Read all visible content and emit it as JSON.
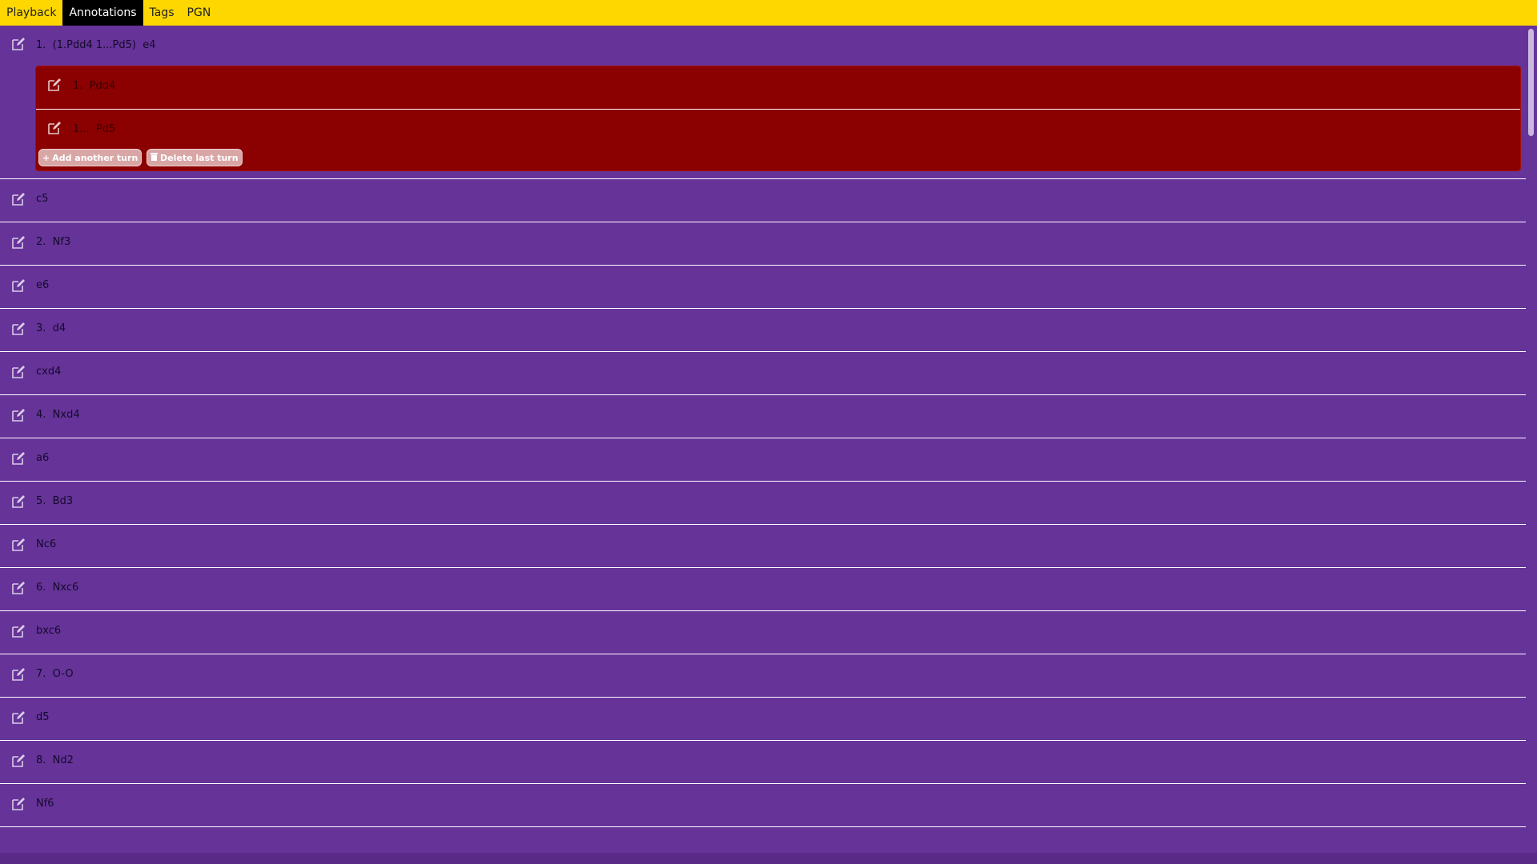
{
  "tabs": [
    {
      "label": "Playback",
      "active": false
    },
    {
      "label": "Annotations",
      "active": true
    },
    {
      "label": "Tags",
      "active": false
    },
    {
      "label": "PGN",
      "active": false
    }
  ],
  "first_move": {
    "label": "1.  (1.Pdd4 1...Pd5)  e4",
    "variation": {
      "moves": [
        "1.  Pdd4",
        "1...  Pd5"
      ],
      "add_label": "Add another turn",
      "delete_label": "Delete last turn"
    }
  },
  "moves": [
    "c5",
    "2.  Nf3",
    "e6",
    "3.  d4",
    "cxd4",
    "4.  Nxd4",
    "a6",
    "5.  Bd3",
    "Nc6",
    "6.  Nxc6",
    "bxc6",
    "7.  O-O",
    "d5",
    "8.  Nd2",
    "Nf6"
  ],
  "colors": {
    "topbar": "#ffd700",
    "background": "#663399",
    "variation": "#8b0000"
  },
  "icons": {
    "edit": "pencil-square-icon",
    "add": "plus-icon",
    "delete": "trash-icon"
  }
}
